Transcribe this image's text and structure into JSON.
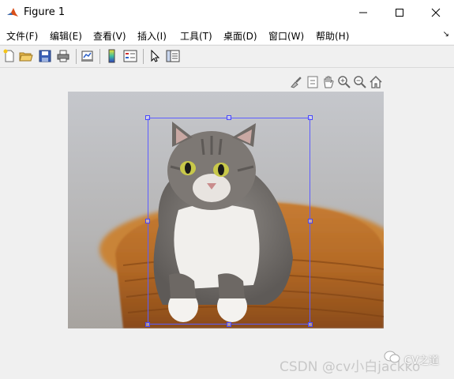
{
  "window": {
    "title": "Figure 1",
    "controls": [
      "minimize-icon",
      "maximize-icon",
      "close-icon"
    ]
  },
  "menu": {
    "items": [
      {
        "label": "文件(F)"
      },
      {
        "label": "编辑(E)"
      },
      {
        "label": "查看(V)"
      },
      {
        "label": "插入(I)"
      },
      {
        "label": "工具(T)"
      },
      {
        "label": "桌面(D)"
      },
      {
        "label": "窗口(W)"
      },
      {
        "label": "帮助(H)"
      }
    ]
  },
  "toolbar": {
    "buttons": [
      "new-figure-icon",
      "open-file-icon",
      "save-icon",
      "print-icon",
      "link-plot-icon",
      "colorbar-icon",
      "legend-icon",
      "edit-plot-arrow-icon",
      "property-inspector-icon"
    ]
  },
  "axes_toolbar": {
    "buttons": [
      "brush-icon",
      "data-tips-icon",
      "pan-icon",
      "zoom-in-icon",
      "zoom-out-icon",
      "home-icon"
    ]
  },
  "image": {
    "subject": "tabby cat in wicker basket",
    "colors": {
      "roi_border": "#5d5dff"
    }
  },
  "watermark": {
    "brand": "CV之道",
    "text": "CSDN @cv小白jackko"
  }
}
